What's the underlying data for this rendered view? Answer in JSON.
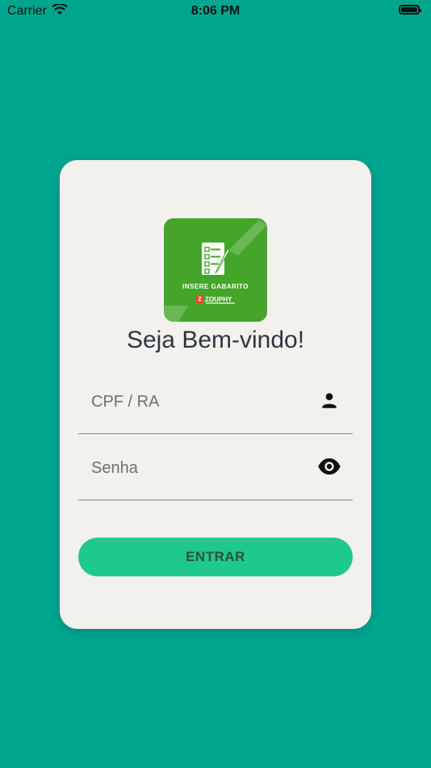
{
  "status_bar": {
    "carrier": "Carrier",
    "time": "8:06 PM"
  },
  "logo": {
    "title": "INSERE GABARITO",
    "brand": "ZOUPHY",
    "brand_mark": "Z"
  },
  "login": {
    "welcome": "Seja Bem-vindo!",
    "cpf_placeholder": "CPF / RA",
    "password_placeholder": "Senha",
    "submit_label": "ENTRAR"
  },
  "colors": {
    "background": "#00a58e",
    "card": "#f2f1ed",
    "logo_bg": "#45a52b",
    "button": "#1fc98a"
  },
  "icons": {
    "cpf_field": "person-icon",
    "password_field": "eye-icon"
  }
}
